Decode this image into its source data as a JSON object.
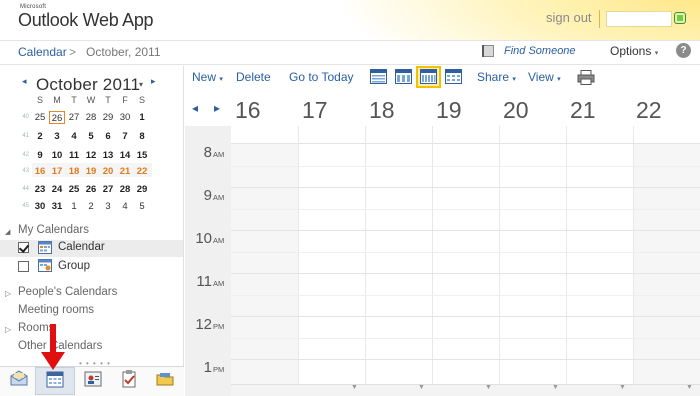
{
  "app": {
    "logo_small": "Microsoft",
    "logo_main": "Outlook Web App",
    "sign_out": "sign out"
  },
  "breadcrumb": {
    "section": "Calendar",
    "separator": ">",
    "current": "October, 2011",
    "find_someone": "Find Someone",
    "options": "Options",
    "help": "?"
  },
  "mini_calendar": {
    "title": "October 2011",
    "prev": "◂",
    "next": "▸",
    "dropdown": "▾",
    "weekday_headers": [
      "S",
      "M",
      "T",
      "W",
      "T",
      "F",
      "S"
    ],
    "weeks": [
      {
        "number": "40",
        "days": [
          "25",
          "26",
          "27",
          "28",
          "29",
          "30",
          "1"
        ]
      },
      {
        "number": "41",
        "days": [
          "2",
          "3",
          "4",
          "5",
          "6",
          "7",
          "8"
        ]
      },
      {
        "number": "42",
        "days": [
          "9",
          "10",
          "11",
          "12",
          "13",
          "14",
          "15"
        ]
      },
      {
        "number": "43",
        "days": [
          "16",
          "17",
          "18",
          "19",
          "20",
          "21",
          "22"
        ]
      },
      {
        "number": "44",
        "days": [
          "23",
          "24",
          "25",
          "26",
          "27",
          "28",
          "29"
        ]
      },
      {
        "number": "45",
        "days": [
          "30",
          "31",
          "1",
          "2",
          "3",
          "4",
          "5"
        ]
      }
    ],
    "today": "26",
    "selected_week": "43"
  },
  "nav": {
    "my_calendars": "My Calendars",
    "calendars": [
      {
        "label": "Calendar",
        "checked": true
      },
      {
        "label": "Group",
        "checked": false
      }
    ],
    "sections": [
      "People's Calendars",
      "Meeting rooms",
      "Rooms",
      "Other Calendars"
    ],
    "grip": "• • • • •"
  },
  "modules": [
    {
      "name": "mail",
      "icon": "mail-icon"
    },
    {
      "name": "calendar",
      "icon": "calendar-icon",
      "active": true
    },
    {
      "name": "contacts",
      "icon": "contacts-icon"
    },
    {
      "name": "tasks",
      "icon": "tasks-icon"
    },
    {
      "name": "public folders",
      "icon": "folder-icon"
    }
  ],
  "toolbar": {
    "new": "New",
    "delete": "Delete",
    "go_to_today": "Go to Today",
    "share": "Share",
    "view": "View",
    "caret": "▾",
    "views": [
      "day",
      "work-week",
      "week",
      "month"
    ],
    "active_view": "week"
  },
  "week": {
    "prev": "◂",
    "next": "▸",
    "days": [
      "16",
      "17",
      "18",
      "19",
      "20",
      "21",
      "22"
    ]
  },
  "time_slots": [
    {
      "hour": "8",
      "suffix": "AM"
    },
    {
      "hour": "9",
      "suffix": "AM"
    },
    {
      "hour": "10",
      "suffix": "AM"
    },
    {
      "hour": "11",
      "suffix": "AM"
    },
    {
      "hour": "12",
      "suffix": "PM"
    },
    {
      "hour": "1",
      "suffix": "PM"
    }
  ],
  "colors": {
    "link": "#2a5fa0",
    "week_highlight": "#e07a1a",
    "active_view_border": "#f2c200",
    "annotation_arrow": "#e01010"
  }
}
